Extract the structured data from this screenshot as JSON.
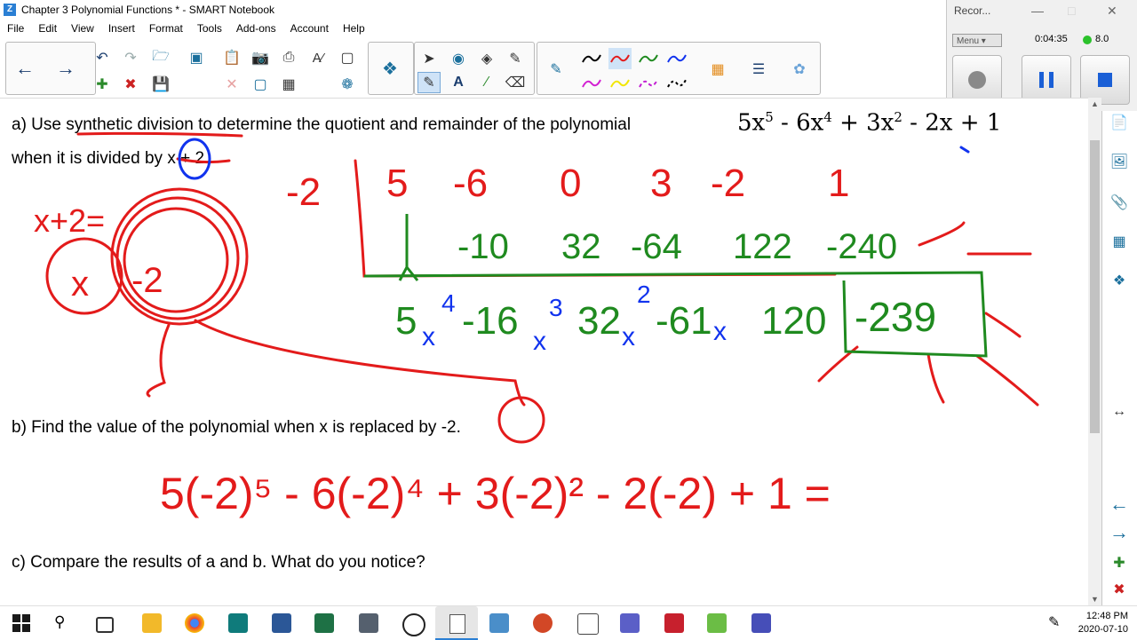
{
  "window": {
    "title": "Chapter 3 Polynomial Functions * - SMART Notebook"
  },
  "menu": [
    "File",
    "Edit",
    "View",
    "Insert",
    "Format",
    "Tools",
    "Add-ons",
    "Account",
    "Help"
  ],
  "recorder": {
    "title": "Recor...",
    "menu_label": "Menu",
    "elapsed": "0:04:35",
    "level": "8.0"
  },
  "page": {
    "question_a_line1": "a)  Use synthetic division to determine the quotient and remainder of the polynomial",
    "question_a_line2": "when it is divided by x + 2.",
    "polynomial": {
      "t1": "5x",
      "e1": "5",
      "t2": " - 6x",
      "e2": "4",
      "t3": " + 3x",
      "e3": "2",
      "t4": " - 2x + 1"
    },
    "question_b": "b)  Find the value of the polynomial when x is replaced by -2.",
    "question_c": "c)  Compare the results of a and b.  What do you notice?"
  },
  "handwriting": {
    "divisor": "-2",
    "coefficients": [
      "5",
      "-6",
      "0",
      "3",
      "-2",
      "1"
    ],
    "products": [
      "-10",
      "32",
      "-64",
      "122",
      "-240"
    ],
    "quotient_terms": [
      "5",
      "-16",
      "32",
      "-61",
      "120"
    ],
    "quotient_exponents": [
      "4",
      "3",
      "2"
    ],
    "quotient_variable": "x",
    "remainder": "-239",
    "note_left": "x+2=",
    "circle_left": "x",
    "circle_right": "-2",
    "substitution": "5(-2)⁵ - 6(-2)⁴ + 3(-2)² - 2(-2) + 1 ="
  },
  "taskbar": {
    "time": "12:48 PM",
    "date": "2020-07-10"
  },
  "colors": {
    "ink_red": "#e31b1b",
    "ink_green": "#1f8a1f",
    "ink_blue": "#1133ee",
    "accent": "#2a7fd4"
  }
}
